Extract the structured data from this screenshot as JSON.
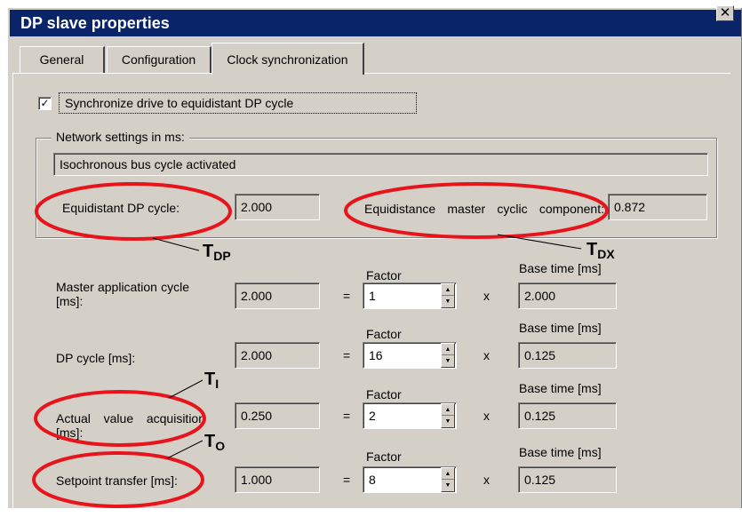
{
  "window": {
    "title": "DP slave properties",
    "close_label": "✕"
  },
  "tabs": [
    {
      "label": "General",
      "active": false
    },
    {
      "label": "Configuration",
      "active": false
    },
    {
      "label": "Clock synchronization",
      "active": true
    }
  ],
  "sync": {
    "checked": true,
    "check_mark": "✓",
    "label": "Synchronize drive to equidistant DP cycle"
  },
  "network": {
    "group_title": "Network settings in ms:",
    "status": "Isochronous bus cycle activated",
    "equidistant_label": "Equidistant DP cycle:",
    "equidistant_value": "2.000",
    "master_label": "Equidistance master cyclic component:",
    "master_value": "0.872"
  },
  "annotations": {
    "t_dp": "T",
    "t_dp_sub": "DP",
    "t_dx": "T",
    "t_dx_sub": "DX",
    "t_i": "T",
    "t_i_sub": "I",
    "t_o": "T",
    "t_o_sub": "O",
    "accent_color": "#e8141c"
  },
  "common": {
    "equals": "=",
    "times": "x",
    "factor_label": "Factor",
    "base_label": "Base time [ms]"
  },
  "rows": [
    {
      "label": "Master application cycle [ms]:",
      "value": "2.000",
      "factor": "1",
      "base": "2.000"
    },
    {
      "label": "DP cycle [ms]:",
      "value": "2.000",
      "factor": "16",
      "base": "0.125"
    },
    {
      "label": "Actual value acquisition [ms]:",
      "value": "0.250",
      "factor": "2",
      "base": "0.125"
    },
    {
      "label": "Setpoint transfer [ms]:",
      "value": "1.000",
      "factor": "8",
      "base": "0.125"
    }
  ]
}
